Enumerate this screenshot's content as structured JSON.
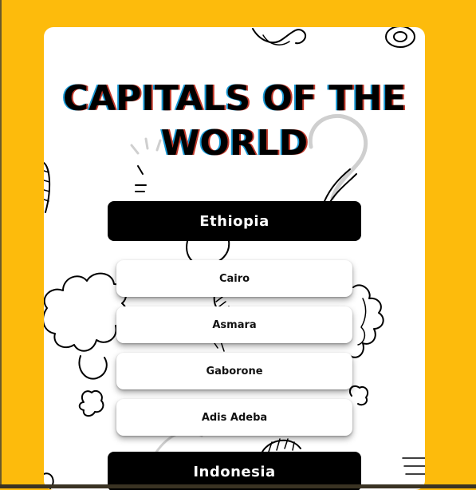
{
  "quiz": {
    "title_line1": "CAPITALS OF THE",
    "title_line2": "WORLD",
    "question": "Ethiopia",
    "options": [
      "Cairo",
      "Asmara",
      "Gaborone",
      "Adis Adeba"
    ],
    "next_question": "Indonesia"
  },
  "colors": {
    "background": "#fdbb0c",
    "card": "#ffffff",
    "country_bar": "#000000"
  },
  "icons": {
    "background": "question-mark-doodles"
  }
}
